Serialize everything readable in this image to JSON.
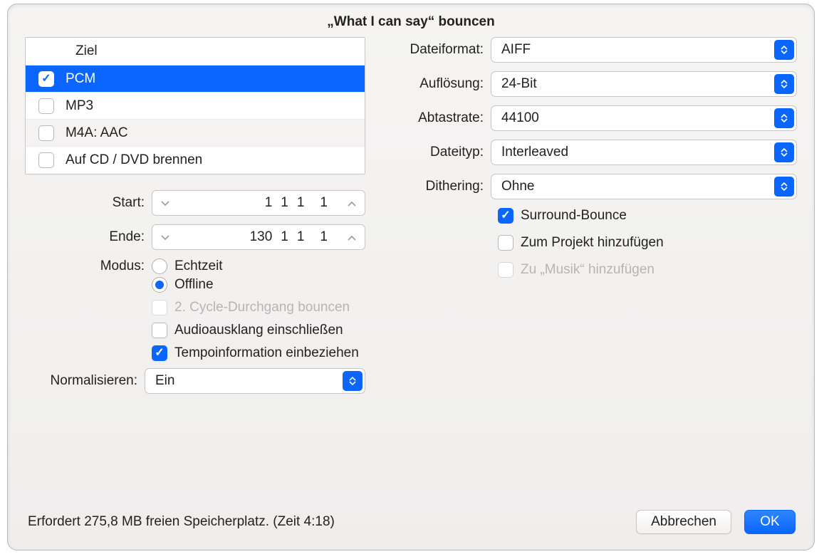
{
  "title": "„What I can say“ bouncen",
  "dest": {
    "header": "Ziel",
    "items": [
      {
        "label": "PCM",
        "checked": true,
        "selected": true
      },
      {
        "label": "MP3",
        "checked": false,
        "selected": false
      },
      {
        "label": "M4A: AAC",
        "checked": false,
        "selected": false
      },
      {
        "label": "Auf CD / DVD brennen",
        "checked": false,
        "selected": false
      }
    ]
  },
  "left": {
    "start_label": "Start:",
    "start_values": [
      "1",
      "1",
      "1",
      "1"
    ],
    "end_label": "Ende:",
    "end_values": [
      "130",
      "1",
      "1",
      "1"
    ],
    "mode_label": "Modus:",
    "mode_realtime": "Echtzeit",
    "mode_offline": "Offline",
    "second_cycle": "2. Cycle-Durchgang bouncen",
    "include_tail": "Audioausklang einschließen",
    "include_tempo": "Tempoinformation einbeziehen",
    "normalize_label": "Normalisieren:",
    "normalize_value": "Ein"
  },
  "right": {
    "file_format_label": "Dateiformat:",
    "file_format_value": "AIFF",
    "resolution_label": "Auflösung:",
    "resolution_value": "24-Bit",
    "sample_rate_label": "Abtastrate:",
    "sample_rate_value": "44100",
    "file_type_label": "Dateityp:",
    "file_type_value": "Interleaved",
    "dithering_label": "Dithering:",
    "dithering_value": "Ohne",
    "surround": "Surround-Bounce",
    "add_project": "Zum Projekt hinzufügen",
    "add_music": "Zu „Musik“ hinzufügen"
  },
  "footer": {
    "status": "Erfordert 275,8 MB freien Speicherplatz. (Zeit 4:18)",
    "cancel": "Abbrechen",
    "ok": "OK"
  }
}
